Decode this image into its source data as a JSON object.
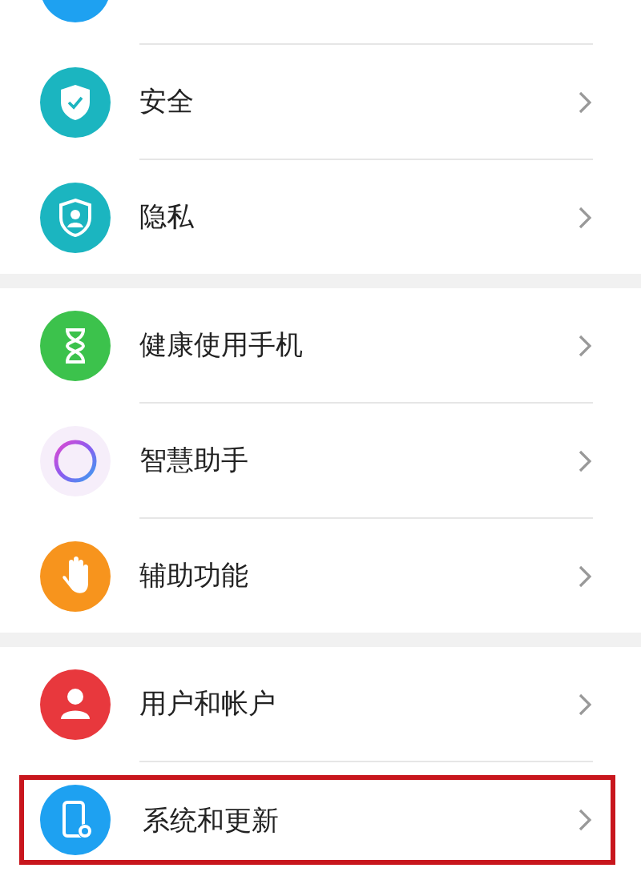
{
  "sections": [
    {
      "items": [
        {
          "kind": "cut-off"
        },
        {
          "kind": "entry",
          "label": "安全",
          "highlighted": false
        },
        {
          "kind": "entry",
          "label": "隐私",
          "highlighted": false
        }
      ]
    },
    {
      "items": [
        {
          "kind": "entry",
          "label": "健康使用手机",
          "highlighted": false
        },
        {
          "kind": "entry",
          "label": "智慧助手",
          "highlighted": false
        },
        {
          "kind": "entry",
          "label": "辅助功能",
          "highlighted": false
        }
      ]
    },
    {
      "items": [
        {
          "kind": "entry",
          "label": "用户和帐户",
          "highlighted": false
        },
        {
          "kind": "entry",
          "label": "系统和更新",
          "highlighted": true
        }
      ]
    }
  ]
}
